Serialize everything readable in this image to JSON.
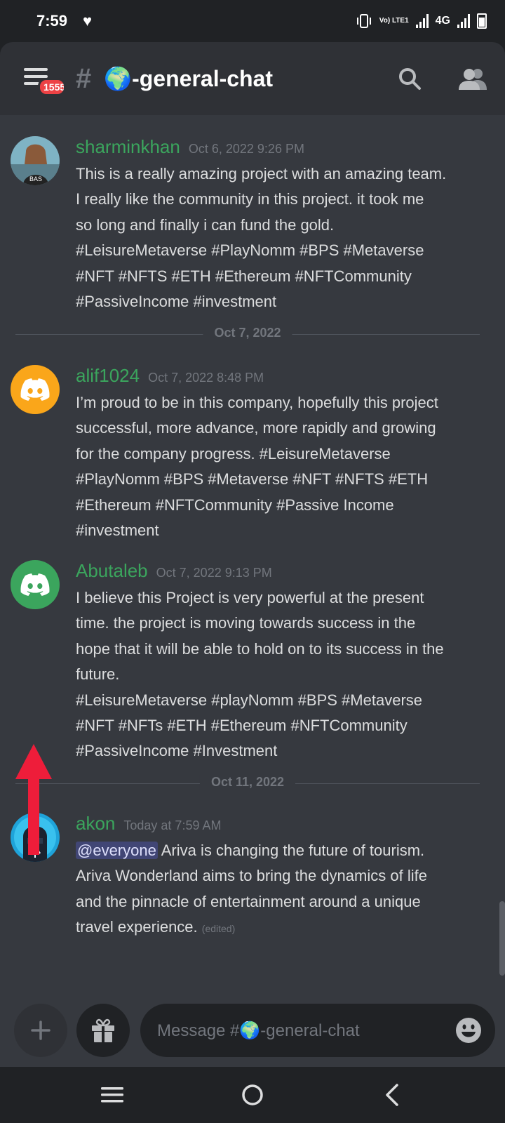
{
  "status_bar": {
    "time": "7:59",
    "heart_icon": "heart-icon",
    "network": "4G",
    "volte": "Vo) LTE1"
  },
  "header": {
    "notification_count": "1555",
    "hash_symbol": "#",
    "channel_name": "🌍-general-chat"
  },
  "colors": {
    "username_green": "#3ba55d",
    "badge_red": "#ed4245",
    "avatar_orange": "#faa61a",
    "avatar_green": "#3ba55d",
    "arrow_red": "#ee1d3a"
  },
  "messages": [
    {
      "username": "sharminkhan",
      "timestamp": "Oct 6, 2022 9:26 PM",
      "avatar": "photo-avatar",
      "lines": [
        "This is a really amazing project with an amazing team.",
        "I really like the community in this project. it took me",
        "so long and finally i can fund the gold.",
        "#LeisureMetaverse #PlayNomm #BPS #Metaverse",
        "#NFT #NFTS #ETH #Ethereum #NFTCommunity",
        "#PassiveIncome #investment"
      ]
    },
    {
      "username": "alif1024",
      "timestamp": "Oct 7, 2022 8:48 PM",
      "avatar": "discord-default-avatar",
      "lines": [
        "I’m proud to be in this company, hopefully this project",
        "successful, more advance, more rapidly and growing",
        "for the company progress. #LeisureMetaverse",
        "#PlayNomm #BPS #Metaverse #NFT #NFTS #ETH",
        "#Ethereum #NFTCommunity #Passive Income",
        "#investment"
      ]
    },
    {
      "username": "Abutaleb",
      "timestamp": "Oct 7, 2022 9:13 PM",
      "avatar": "discord-default-avatar",
      "lines": [
        "I believe this Project is very powerful at the present",
        "time. the project is moving towards success in the",
        "hope that it will be able to hold on to its success in the",
        "future.",
        "#LeisureMetaverse #playNomm #BPS #Metaverse",
        "#NFT #NFTs #ETH #Ethereum #NFTCommunity",
        "#PassiveIncome #Investment"
      ]
    },
    {
      "username": "akon",
      "timestamp": "Today at 7:59 AM",
      "avatar": "photo-avatar",
      "mention": "@everyone",
      "line1_rest": " Ariva is changing the future of tourism.",
      "lines": [
        "Ariva Wonderland aims to bring the dynamics of life",
        "and the pinnacle of entertainment around a unique",
        "travel experience."
      ],
      "edited_label": "(edited)"
    }
  ],
  "dividers": [
    {
      "label": "Oct 7, 2022"
    },
    {
      "label": "Oct 11, 2022"
    }
  ],
  "composer": {
    "placeholder": "Message #🌍-general-chat"
  }
}
